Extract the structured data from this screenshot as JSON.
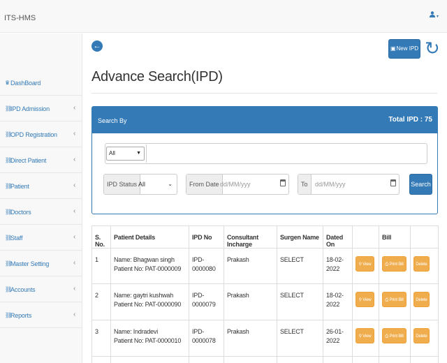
{
  "app": {
    "brand": "ITS-HMS"
  },
  "header": {
    "user_icon": "user-icon",
    "caret": "▾"
  },
  "sidebar": {
    "items": [
      {
        "label": "DashBoard",
        "has_submenu": false
      },
      {
        "label": "IPD Admission",
        "has_submenu": true
      },
      {
        "label": "OPD Registration",
        "has_submenu": true
      },
      {
        "label": "Direct Patient",
        "has_submenu": true
      },
      {
        "label": "Patient",
        "has_submenu": true
      },
      {
        "label": "Doctors",
        "has_submenu": true
      },
      {
        "label": "Staff",
        "has_submenu": true
      },
      {
        "label": "Master Setting",
        "has_submenu": true
      },
      {
        "label": "Accounts",
        "has_submenu": true
      },
      {
        "label": "Reports",
        "has_submenu": true
      }
    ]
  },
  "page": {
    "title": "Advance Search(IPD)",
    "new_button_label": "New IPD"
  },
  "search_panel": {
    "heading": "Search By",
    "total": "Total IPD : 75",
    "field_select_value": "All",
    "search_text": "",
    "ipd_status_label": "IPD Status",
    "ipd_status_value": "All",
    "from_date_label": "From Date",
    "from_date_placeholder": "dd/MM/yyy",
    "to_label": "To",
    "to_date_placeholder": "dd/MM/yyy",
    "search_button": "Search"
  },
  "table": {
    "columns": [
      "S. No.",
      "Patient Details",
      "IPD No",
      "Consultant Incharge",
      "Surgen Name",
      "Dated On",
      "",
      "Bill",
      ""
    ],
    "rows": [
      {
        "sno": "1",
        "name": "Name: Bhagwan  singh",
        "patient_no": "Patient No: PAT-0000009",
        "ipd_no": "IPD-0000080",
        "consultant": "Prakash",
        "surgeon": "SELECT",
        "date": "18-02-2022"
      },
      {
        "sno": "2",
        "name": "Name: gaytri  kushwah",
        "patient_no": "Patient No: PAT-0000090",
        "ipd_no": "IPD-0000079",
        "consultant": "Prakash",
        "surgeon": "SELECT",
        "date": "18-02-2022"
      },
      {
        "sno": "3",
        "name": "Name: Indradevi",
        "patient_no": "Patient No: PAT-0000010",
        "ipd_no": "IPD-0000078",
        "consultant": "Prakash",
        "surgeon": "SELECT",
        "date": "26-01-2022"
      }
    ],
    "actions": {
      "view": "View",
      "print": "Print Bill",
      "delete": "Delete"
    }
  },
  "colors": {
    "primary": "#337ab7",
    "warning": "#f0ad4e",
    "sidebar_bg": "#f8f8f8"
  }
}
